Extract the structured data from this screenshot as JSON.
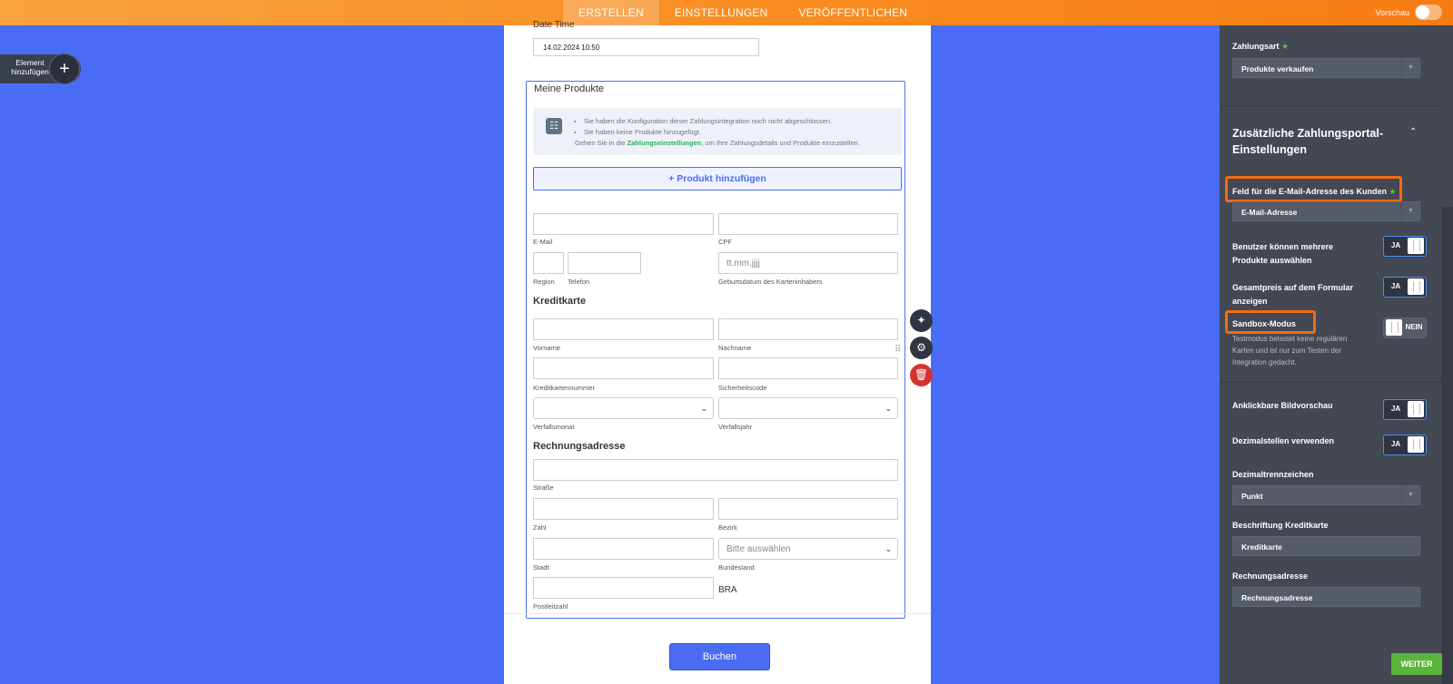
{
  "topbar": {
    "tabs": [
      {
        "label": "ERSTELLEN",
        "active": true
      },
      {
        "label": "EINSTELLUNGEN",
        "active": false
      },
      {
        "label": "VERÖFFENTLICHEN",
        "active": false
      }
    ],
    "preview_label": "Vorschau"
  },
  "add_element": {
    "label": "Element hinzufügen"
  },
  "form": {
    "datetime_label": "Date Time",
    "datetime_value": "14.02.2024 10:50",
    "products_title": "Meine Produkte",
    "info": {
      "line1": "Sie haben die Konfiguration dieser Zahlungsintegration noch nicht abgeschlossen.",
      "line2": "Sie haben keine Produkte hinzugefügt.",
      "line3_prefix": "Gehen Sie in die ",
      "line3_link": "Zahlungseinstellungen",
      "line3_suffix": ", um Ihre Zahlungsdetails und Produkte einzustellen."
    },
    "add_product_label": "+ Produkt hinzufügen",
    "labels": {
      "email": "E-Mail",
      "cpf": "CPF",
      "region": "Region",
      "telefon": "Telefon",
      "birthdate": "Geburtsdatum des Karteninhabers",
      "birthdate_placeholder": "tt.mm.jjjj",
      "kreditkarte": "Kreditkarte",
      "vorname": "Vorname",
      "nachname": "Nachname",
      "kartennummer": "Kreditkartennummer",
      "sicherheitscode": "Sicherheitscode",
      "verfallsmonat": "Verfallsmonat",
      "verfallsjahr": "Verfallsjahr",
      "rechnungsadresse": "Rechnungsadresse",
      "strasse": "Straße",
      "zahl": "Zahl",
      "bezirk": "Bezirk",
      "stadt": "Stadt",
      "bundesland": "Bundesland",
      "bundesland_placeholder": "Bitte auswählen",
      "postleitzahl": "Postleitzahl",
      "country": "BRA"
    },
    "submit_label": "Buchen"
  },
  "panel": {
    "zahlungsart_label": "Zahlungsart",
    "zahlungsart_value": "Produkte verkaufen",
    "section_title": "Zusätzliche Zahlungsportal-Einstellungen",
    "email_field_label": "Feld für die E-Mail-Adresse des Kunden",
    "email_field_value": "E-Mail-Adresse",
    "multi_products_label": "Benutzer können mehrere Produkte auswählen",
    "multi_products_state": "JA",
    "total_price_label": "Gesamtpreis auf dem Formular anzeigen",
    "total_price_state": "JA",
    "sandbox_label": "Sandbox-Modus",
    "sandbox_desc": "Testmodus belastet keine regulären Karten und ist nur zum Testen der Integration gedacht.",
    "sandbox_state": "NEIN",
    "image_preview_label": "Anklickbare Bildvorschau",
    "image_preview_state": "JA",
    "decimals_label": "Dezimalstellen verwenden",
    "decimals_state": "JA",
    "decimal_sep_label": "Dezimaltrennzeichen",
    "decimal_sep_value": "Punkt",
    "card_caption_label": "Beschriftung Kreditkarte",
    "card_caption_value": "Kreditkarte",
    "billing_label": "Rechnungsadresse",
    "billing_value": "Rechnungsadresse"
  },
  "next_button": "WEITER",
  "colors": {
    "brand_orange": "#f98a1e",
    "canvas_blue": "#4a6cf5",
    "panel_bg": "#434853",
    "highlight": "#f46b12",
    "success": "#5bb53b"
  }
}
